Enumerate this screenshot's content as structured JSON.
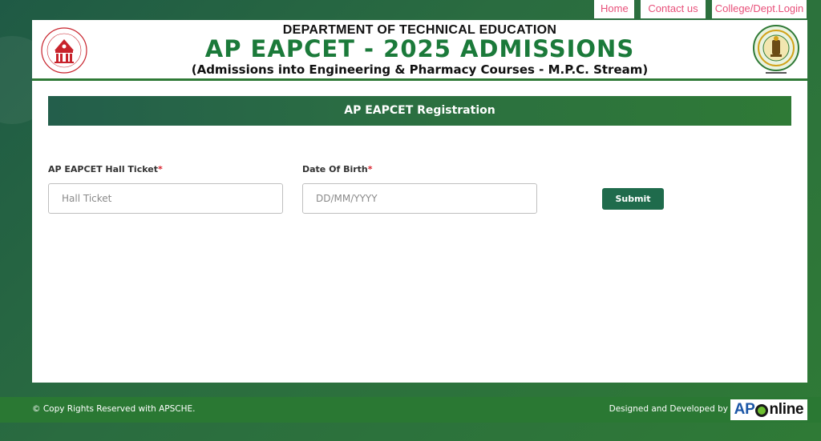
{
  "nav": {
    "home": "Home",
    "contact": "Contact us",
    "login": "College/Dept.Login"
  },
  "header": {
    "department": "DEPARTMENT OF TECHNICAL EDUCATION",
    "title": "AP EAPCET - 2025 ADMISSIONS",
    "subtitle": "(Admissions into Engineering & Pharmacy Courses - M.P.C. Stream)",
    "left_logo_icon": "apsche-emblem-icon",
    "right_logo_icon": "ap-state-emblem-icon"
  },
  "form": {
    "title": "AP EAPCET Registration",
    "hall_ticket_label": "AP EAPCET Hall Ticket",
    "hall_ticket_placeholder": "Hall Ticket",
    "hall_ticket_value": "",
    "dob_label": "Date Of Birth",
    "dob_placeholder": "DD/MM/YYYY",
    "dob_value": "",
    "required_marker": "*",
    "submit_label": "Submit"
  },
  "footer": {
    "copyright": "© Copy Rights Reserved with APSCHE.",
    "designed_by": "Designed and Developed by",
    "brand_ap": "AP",
    "brand_rest": "nline"
  },
  "colors": {
    "primary_green": "#2f7a36",
    "dark_green": "#1f6b4c",
    "nav_text": "#e8507a",
    "required": "#d9232e"
  }
}
